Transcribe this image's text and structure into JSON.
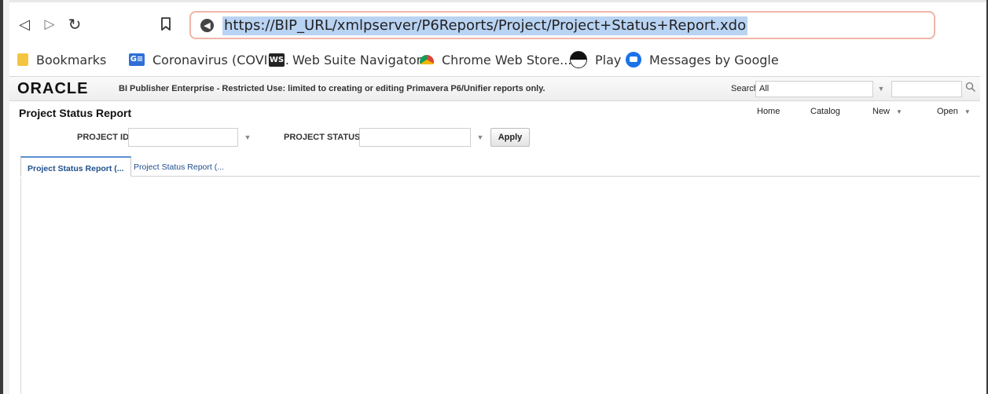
{
  "browser": {
    "url": "https://BIP_URL/xmlpserver/P6Reports/Project/Project+Status+Report.xdo",
    "icons": {
      "back": "back-arrow-icon",
      "forward": "forward-arrow-icon",
      "reload": "reload-icon",
      "bookmark": "bookmark-icon",
      "site_info": "site-info-icon"
    },
    "accent_colors": {
      "address_border": "#efb5a8",
      "url_highlight": "#b9d3f3"
    }
  },
  "bookmarks": [
    {
      "label": "Bookmarks",
      "icon": "folder-icon"
    },
    {
      "label": "Coronavirus (COVID...",
      "icon": "google-sheets-icon",
      "badge": "G≡"
    },
    {
      "label": "Web Suite Navigator",
      "icon": "web-suite-icon",
      "badge": "WS"
    },
    {
      "label": "Chrome Web Store...",
      "icon": "chrome-store-icon"
    },
    {
      "label": "Play",
      "icon": "play-icon"
    },
    {
      "label": "Messages by Google",
      "icon": "messages-icon"
    }
  ],
  "bi_header": {
    "logo": "ORACLE",
    "tagline": "BI Publisher Enterprise - Restricted Use: limited to creating or editing Primavera P6/Unifier reports only.",
    "search_label": "Search",
    "search_scope": "All"
  },
  "report": {
    "title": "Project Status Report",
    "nav": {
      "home": "Home",
      "catalog": "Catalog",
      "new": "New",
      "open": "Open"
    }
  },
  "parameters": {
    "project_id_label": "PROJECT ID",
    "project_id_value": "",
    "project_status_label": "PROJECT STATUS",
    "project_status_value": "",
    "apply_label": "Apply"
  },
  "tabs": [
    {
      "label": "Project Status Report (...",
      "active": true
    },
    {
      "label": "Project Status Report (...",
      "active": false
    }
  ]
}
